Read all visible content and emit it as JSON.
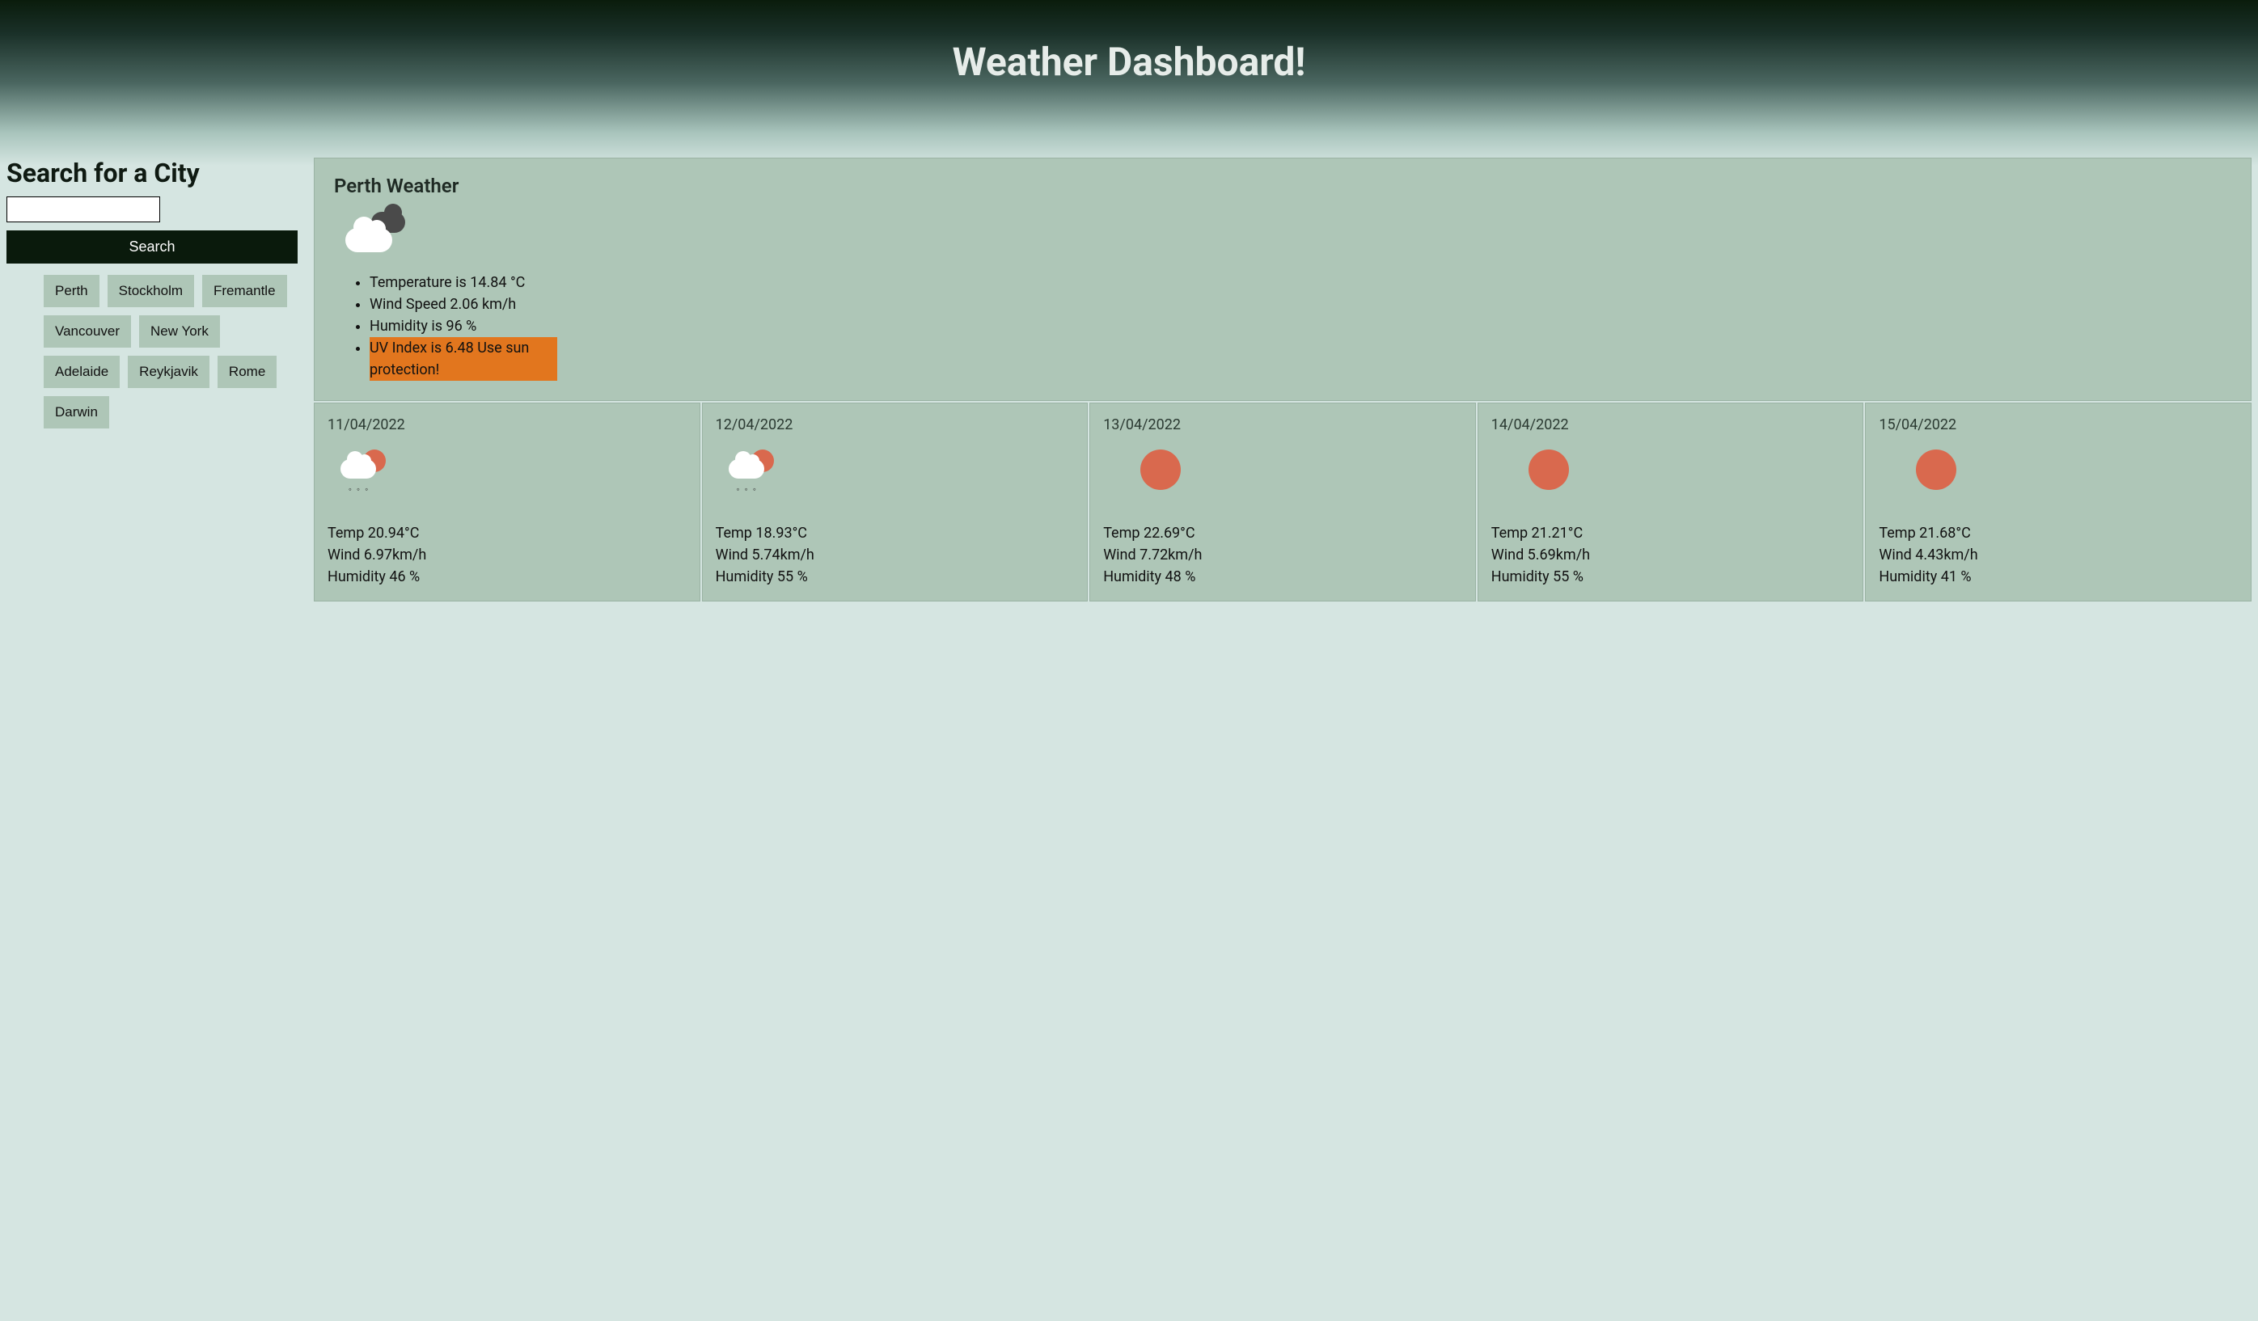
{
  "header": {
    "title": "Weather Dashboard!"
  },
  "sidebar": {
    "heading": "Search for a City",
    "search_value": "",
    "search_button": "Search",
    "history": [
      "Perth",
      "Stockholm",
      "Fremantle",
      "Vancouver",
      "New York",
      "Adelaide",
      "Reykjavik",
      "Rome",
      "Darwin"
    ]
  },
  "current": {
    "title": "Perth Weather",
    "icon": "clouds",
    "temperature": "Temperature is 14.84 °C",
    "wind": "Wind Speed 2.06 km/h",
    "humidity": "Humidity is 96 %",
    "uv": "UV Index is 6.48 Use sun protection!",
    "uv_highlight_color": "#e2761e"
  },
  "forecast": [
    {
      "date": "11/04/2022",
      "icon": "rain-sun",
      "temp": "Temp 20.94°C",
      "wind": "Wind 6.97km/h",
      "humidity": "Humidity 46 %"
    },
    {
      "date": "12/04/2022",
      "icon": "rain-sun",
      "temp": "Temp 18.93°C",
      "wind": "Wind 5.74km/h",
      "humidity": "Humidity 55 %"
    },
    {
      "date": "13/04/2022",
      "icon": "sun",
      "temp": "Temp 22.69°C",
      "wind": "Wind 7.72km/h",
      "humidity": "Humidity 48 %"
    },
    {
      "date": "14/04/2022",
      "icon": "sun",
      "temp": "Temp 21.21°C",
      "wind": "Wind 5.69km/h",
      "humidity": "Humidity 55 %"
    },
    {
      "date": "15/04/2022",
      "icon": "sun",
      "temp": "Temp 21.68°C",
      "wind": "Wind 4.43km/h",
      "humidity": "Humidity 41 %"
    }
  ]
}
